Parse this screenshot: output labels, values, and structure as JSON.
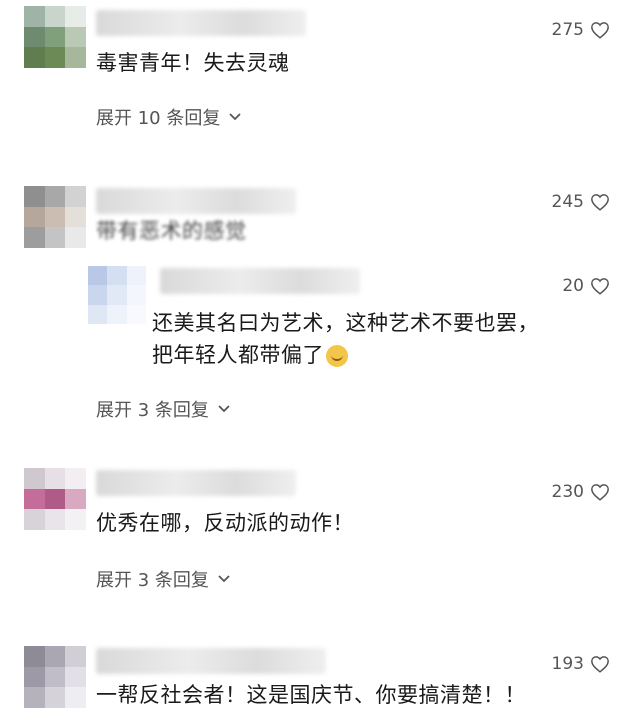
{
  "comments": [
    {
      "likes": "275",
      "text": "毒害青年！失去灵魂",
      "expand_label": "展开 10 条回复",
      "avatar_colors": [
        "#9fb3a6",
        "#c9d4ca",
        "#e7ece8",
        "#6e8a6f",
        "#7fa07a",
        "#b9c9b3",
        "#5f7d4e",
        "#6c8a55",
        "#a7b79b"
      ]
    },
    {
      "likes": "245",
      "text": "带有恶术的感觉",
      "avatar_colors": [
        "#8f8f8f",
        "#a8a8a8",
        "#d2d2d2",
        "#b6a79c",
        "#cbbdb2",
        "#e5dfd9",
        "#9d9d9d",
        "#c4c4c4",
        "#e9e9e9"
      ],
      "reply": {
        "likes": "20",
        "text_line1": "还美其名曰为艺术，这种艺术不要也罢，",
        "text_line2": "把年轻人都带偏了",
        "avatar_colors": [
          "#b9c8e6",
          "#d4dff2",
          "#eef3fb",
          "#c9d6ee",
          "#e1e9f7",
          "#f3f6fc",
          "#dfe7f5",
          "#eef2fa",
          "#f7f9fd"
        ]
      },
      "expand_label": "展开 3 条回复"
    },
    {
      "likes": "230",
      "text": "优秀在哪，反动派的动作！",
      "expand_label": "展开 3 条回复",
      "avatar_colors": [
        "#cfc9cf",
        "#e6dfe6",
        "#f2eef2",
        "#c46d9a",
        "#b05a87",
        "#d9a9c2",
        "#d8d3d8",
        "#e9e4e9",
        "#f4f1f4"
      ]
    },
    {
      "likes": "193",
      "text": "一帮反社会者！这是国庆节、你要搞清楚！！",
      "avatar_colors": [
        "#8e8a96",
        "#aaa6b2",
        "#d1ced6",
        "#9d99a6",
        "#c0bcc8",
        "#e2e0e6",
        "#b5b1bd",
        "#d5d2da",
        "#eeeef2"
      ]
    }
  ]
}
